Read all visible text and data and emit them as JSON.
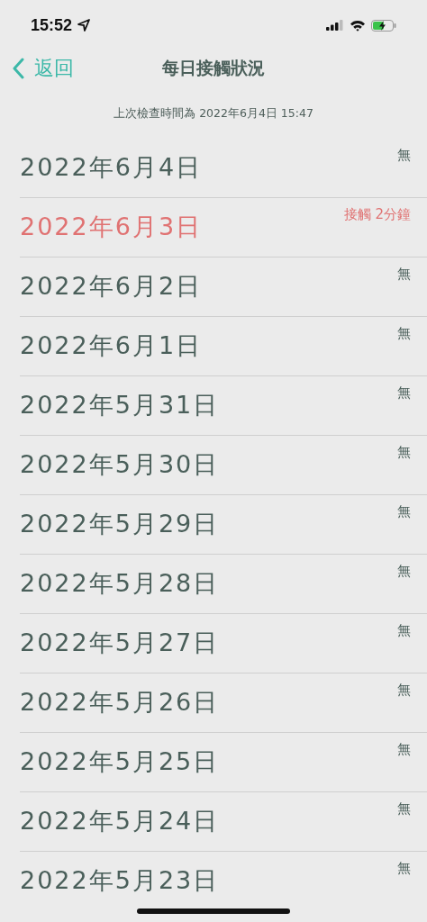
{
  "status_bar": {
    "time": "15:52"
  },
  "nav": {
    "back": "返回",
    "title": "每日接觸狀況"
  },
  "last_checked": "上次檢查時間為 2022年6月4日 15:47",
  "days": [
    {
      "date": "2022年6月4日",
      "status": "無",
      "exposed": false
    },
    {
      "date": "2022年6月3日",
      "status": "接觸 2分鐘",
      "exposed": true
    },
    {
      "date": "2022年6月2日",
      "status": "無",
      "exposed": false
    },
    {
      "date": "2022年6月1日",
      "status": "無",
      "exposed": false
    },
    {
      "date": "2022年5月31日",
      "status": "無",
      "exposed": false
    },
    {
      "date": "2022年5月30日",
      "status": "無",
      "exposed": false
    },
    {
      "date": "2022年5月29日",
      "status": "無",
      "exposed": false
    },
    {
      "date": "2022年5月28日",
      "status": "無",
      "exposed": false
    },
    {
      "date": "2022年5月27日",
      "status": "無",
      "exposed": false
    },
    {
      "date": "2022年5月26日",
      "status": "無",
      "exposed": false
    },
    {
      "date": "2022年5月25日",
      "status": "無",
      "exposed": false
    },
    {
      "date": "2022年5月24日",
      "status": "無",
      "exposed": false
    },
    {
      "date": "2022年5月23日",
      "status": "無",
      "exposed": false
    }
  ]
}
